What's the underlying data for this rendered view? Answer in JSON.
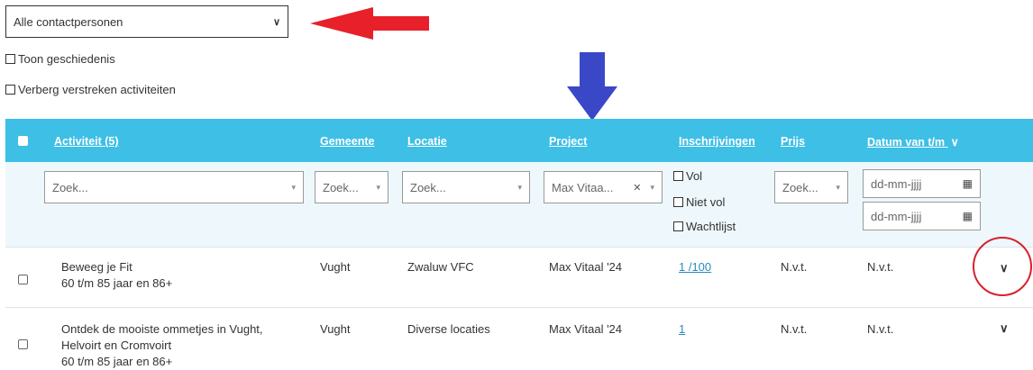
{
  "contact_select": {
    "value": "Alle contactpersonen"
  },
  "options": {
    "show_history": "Toon geschiedenis",
    "hide_expired": "Verberg verstreken activiteiten"
  },
  "table": {
    "headers": {
      "activity": "Activiteit (5)",
      "municipality": "Gemeente",
      "location": "Locatie",
      "project": "Project",
      "registrations": "Inschrijvingen",
      "price": "Prijs",
      "date": "Datum van t/m"
    },
    "filters": {
      "activity_placeholder": "Zoek...",
      "municipality_placeholder": "Zoek...",
      "location_placeholder": "Zoek...",
      "project_value": "Max Vitaa...",
      "registrations_options": [
        "Vol",
        "Niet vol",
        "Wachtlijst"
      ],
      "price_placeholder": "Zoek...",
      "date_from_placeholder": "dd-mm-jjjj",
      "date_to_placeholder": "dd-mm-jjjj"
    },
    "rows": [
      {
        "activity_title": "Beweeg je Fit",
        "activity_sub": "60 t/m 85 jaar en 86+",
        "municipality": "Vught",
        "location": "Zwaluw VFC",
        "project": "Max Vitaal '24",
        "registrations": "1 /100",
        "price": "N.v.t.",
        "date": "N.v.t."
      },
      {
        "activity_title_1": "Ontdek de mooiste ommetjes in Vught,",
        "activity_title_2": "Helvoirt en Cromvoirt",
        "activity_sub": "60 t/m 85 jaar en 86+",
        "municipality": "Vught",
        "location": "Diverse locaties",
        "project": "Max Vitaal '24",
        "registrations": "1",
        "price": "N.v.t.",
        "date": "N.v.t."
      }
    ]
  },
  "annotations": {
    "red_arrow_color": "#e8202a",
    "blue_arrow_color": "#3a48c8",
    "circle_color": "#d9202a"
  },
  "colors": {
    "header_bg": "#3dbfe6",
    "filter_bg": "#eef8fc",
    "link": "#2a8bbd"
  }
}
